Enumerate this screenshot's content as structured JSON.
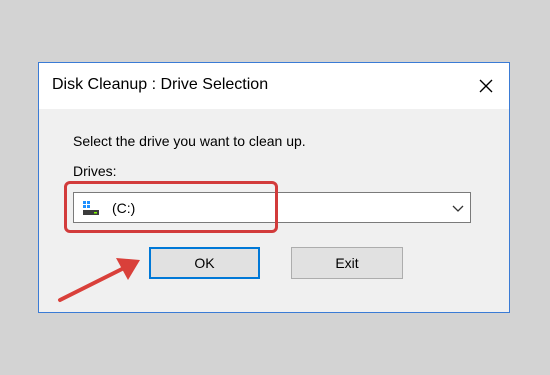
{
  "dialog": {
    "title": "Disk Cleanup : Drive Selection",
    "close_glyph": "✕",
    "prompt": "Select the drive you want to clean up.",
    "drives_label": "Drives:",
    "selected_drive": "(C:)",
    "ok_label": "OK",
    "exit_label": "Exit"
  },
  "colors": {
    "highlight": "#d23b3b",
    "accent": "#0078d7",
    "background": "#d3d3d3"
  },
  "icons": {
    "drive": "drive-icon",
    "dropdown": "chevron-down-icon",
    "close": "close-icon",
    "pointer": "arrow-icon"
  }
}
